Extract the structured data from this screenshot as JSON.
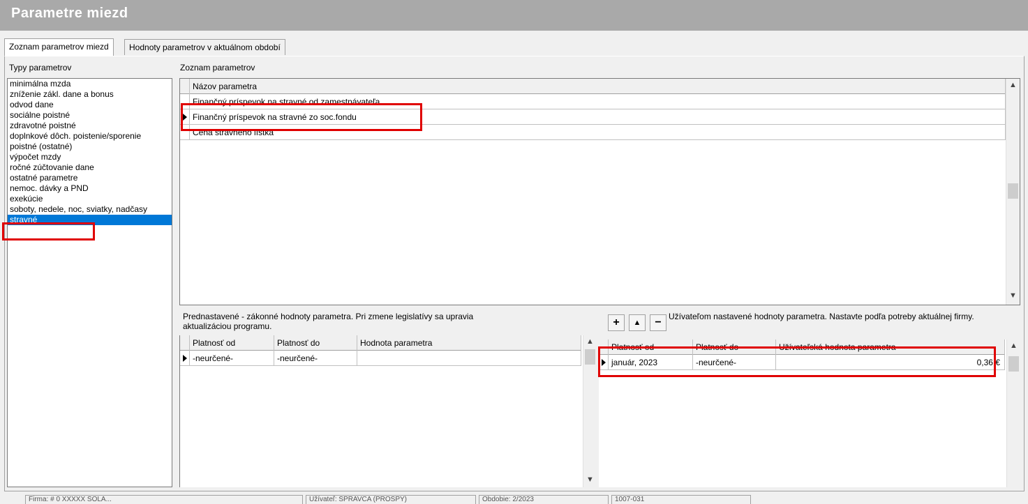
{
  "window": {
    "title": "Parametre miezd"
  },
  "tabs": [
    {
      "label": "Zoznam parametrov miezd"
    },
    {
      "label": "Hodnoty parametrov v aktuálnom období"
    }
  ],
  "left_panel": {
    "label": "Typy parametrov",
    "items": [
      "minimálna mzda",
      "zníženie zákl. dane a bonus",
      "odvod dane",
      "sociálne poistné",
      "zdravotné poistné",
      "doplnkové dôch. poistenie/sporenie",
      "poistné (ostatné)",
      "výpočet mzdy",
      "ročné zúčtovanie dane",
      "ostatné parametre",
      "nemoc. dávky a PND",
      "exekúcie",
      "soboty, nedele, noc, sviatky, nadčasy",
      "stravné"
    ],
    "selected": "stravné"
  },
  "params_grid": {
    "label": "Zoznam parametrov",
    "header": "Názov parametra",
    "rows": [
      "Finančný príspevok na stravné od zamestnávateľa",
      "Finančný príspevok na stravné zo soc.fondu",
      "Cena stravného lístka"
    ],
    "current_row": 1
  },
  "default_values": {
    "description": "Prednastavené - zákonné hodnoty parametra. Pri zmene legislatívy sa upravia aktualizáciou programu.",
    "columns": [
      "Platnosť od",
      "Platnosť do",
      "Hodnota parametra"
    ],
    "rows": [
      {
        "from": "-neurčené-",
        "to": "-neurčené-",
        "value": ""
      }
    ]
  },
  "user_values": {
    "description": "Užívateľom nastavené hodnoty parametra. Nastavte podľa potreby aktuálnej firmy.",
    "buttons": {
      "add": "+",
      "up": "▲",
      "remove": "−"
    },
    "columns": [
      "Platnosť od",
      "Platnosť do",
      "Užívateľská hodnota parametra"
    ],
    "rows": [
      {
        "from": "január, 2023",
        "to": "-neurčené-",
        "value": "0,36 €"
      }
    ]
  },
  "statusbar": {
    "segments": [
      "Firma: # 0 XXXXX SOLA...",
      "Užívateľ: SPRAVCA (PROSPY)",
      "Obdobie: 2/2023",
      "1007-031"
    ]
  },
  "colors": {
    "title_bar": "#a9a9a9",
    "selection": "#0078d7",
    "highlight": "#e00000"
  }
}
